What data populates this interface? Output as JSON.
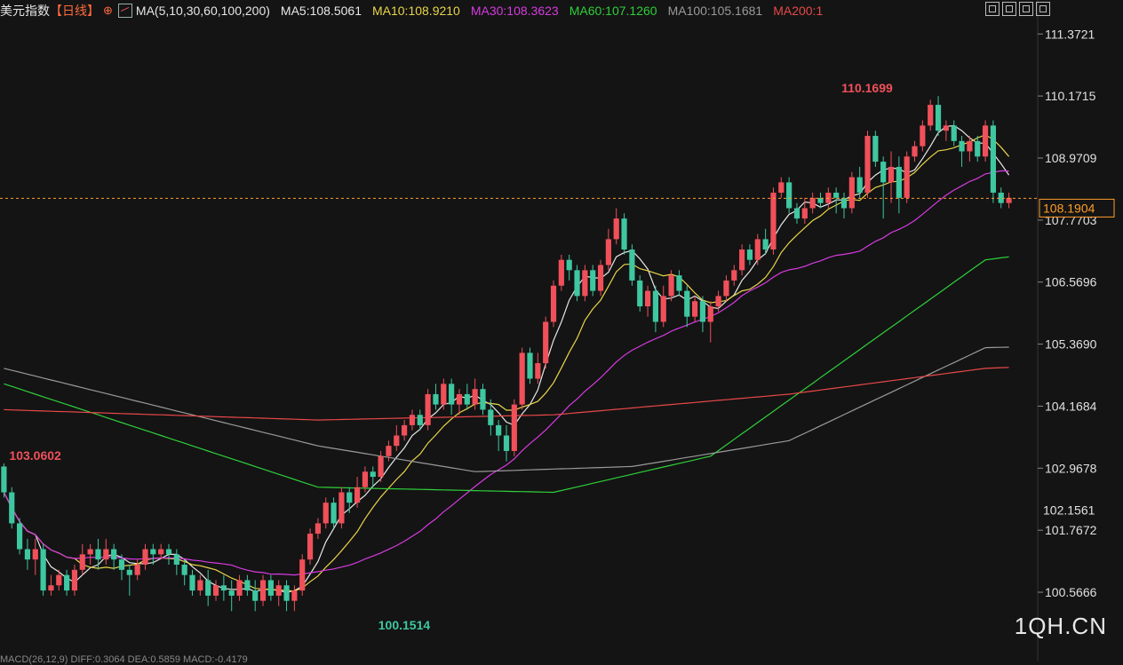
{
  "legend": {
    "title": "美元指数",
    "period": "【日线】",
    "ma_spec": "MA(5,10,30,60,100,200)",
    "items": [
      {
        "label": "MA5:108.5061",
        "color": "#e8e8e8"
      },
      {
        "label": "MA10:108.9210",
        "color": "#e8d44a"
      },
      {
        "label": "MA30:108.3623",
        "color": "#d63be0"
      },
      {
        "label": "MA60:107.1260",
        "color": "#2fcf3a"
      },
      {
        "label": "MA100:105.1681",
        "color": "#9a9a9a"
      },
      {
        "label": "MA200:1",
        "color": "#e84848"
      }
    ]
  },
  "colors": {
    "up": "#f0505a",
    "down": "#3ec7a0",
    "axis_text": "#e0e0e0",
    "price_label": "#ff9d2a",
    "current_line": "#ff9d2a"
  },
  "watermark": "1QH.CN",
  "bottom_indicator": "MACD(26,12,9) DIFF:0.3064 DEA:0.5859 MACD:-0.4179",
  "chart_data": {
    "type": "candlestick",
    "y_ticks": [
      "111.3721",
      "110.1715",
      "108.9709",
      "107.7703",
      "106.5696",
      "105.3690",
      "104.1684",
      "102.9678",
      "101.7672",
      "100.5666"
    ],
    "ylim": [
      100.0,
      111.6
    ],
    "current_price": "108.1904",
    "marker_price": "102.1561",
    "annotations": [
      {
        "text": "110.1699",
        "index": 106,
        "value": 110.1699,
        "color": "#f0505a"
      },
      {
        "text": "103.0602",
        "index": 0,
        "value": 103.0602,
        "color": "#f0505a"
      },
      {
        "text": "100.1514",
        "index": 47,
        "value": 100.1514,
        "color": "#3ec7a0"
      }
    ],
    "candles": [
      [
        103.0,
        102.5,
        103.06,
        102.4
      ],
      [
        102.5,
        101.9,
        102.6,
        101.8
      ],
      [
        101.9,
        101.4,
        102.0,
        101.3
      ],
      [
        101.4,
        101.2,
        101.6,
        101.0
      ],
      [
        101.2,
        101.4,
        101.6,
        100.9
      ],
      [
        101.4,
        100.6,
        101.5,
        100.5
      ],
      [
        100.6,
        100.7,
        100.9,
        100.5
      ],
      [
        100.7,
        100.9,
        101.0,
        100.6
      ],
      [
        100.9,
        100.6,
        101.0,
        100.5
      ],
      [
        100.6,
        101.0,
        101.1,
        100.5
      ],
      [
        101.0,
        101.3,
        101.5,
        100.9
      ],
      [
        101.3,
        101.4,
        101.5,
        101.1
      ],
      [
        101.4,
        101.2,
        101.6,
        101.0
      ],
      [
        101.2,
        101.4,
        101.6,
        101.1
      ],
      [
        101.4,
        101.2,
        101.5,
        101.0
      ],
      [
        101.2,
        101.0,
        101.3,
        100.8
      ],
      [
        101.0,
        100.9,
        101.1,
        100.5
      ],
      [
        100.9,
        101.1,
        101.2,
        100.8
      ],
      [
        101.1,
        101.4,
        101.5,
        101.0
      ],
      [
        101.4,
        101.3,
        101.5,
        101.1
      ],
      [
        101.3,
        101.4,
        101.5,
        101.2
      ],
      [
        101.4,
        101.3,
        101.5,
        101.1
      ],
      [
        101.3,
        101.1,
        101.4,
        100.9
      ],
      [
        101.1,
        100.9,
        101.2,
        100.7
      ],
      [
        100.9,
        100.6,
        101.0,
        100.5
      ],
      [
        100.6,
        100.8,
        100.9,
        100.5
      ],
      [
        100.8,
        100.5,
        101.0,
        100.3
      ],
      [
        100.5,
        100.7,
        100.8,
        100.4
      ],
      [
        100.7,
        100.6,
        100.9,
        100.4
      ],
      [
        100.6,
        100.5,
        100.8,
        100.2
      ],
      [
        100.5,
        100.8,
        100.9,
        100.4
      ],
      [
        100.8,
        100.6,
        100.9,
        100.5
      ],
      [
        100.6,
        100.4,
        100.8,
        100.2
      ],
      [
        100.4,
        100.8,
        100.9,
        100.3
      ],
      [
        100.8,
        100.5,
        100.9,
        100.4
      ],
      [
        100.5,
        100.7,
        100.8,
        100.3
      ],
      [
        100.7,
        100.4,
        100.8,
        100.2
      ],
      [
        100.4,
        100.6,
        100.7,
        100.2
      ],
      [
        100.6,
        101.2,
        101.3,
        100.5
      ],
      [
        101.2,
        101.7,
        101.8,
        101.1
      ],
      [
        101.7,
        101.9,
        102.0,
        101.6
      ],
      [
        101.9,
        102.3,
        102.4,
        101.8
      ],
      [
        102.3,
        101.9,
        102.4,
        101.8
      ],
      [
        101.9,
        102.5,
        102.6,
        101.8
      ],
      [
        102.5,
        102.3,
        102.6,
        102.1
      ],
      [
        102.3,
        102.6,
        102.8,
        102.2
      ],
      [
        102.6,
        102.9,
        103.0,
        102.5
      ],
      [
        102.9,
        102.8,
        103.0,
        102.6
      ],
      [
        102.8,
        103.2,
        103.3,
        102.7
      ],
      [
        103.2,
        103.4,
        103.5,
        103.1
      ],
      [
        103.4,
        103.6,
        103.8,
        103.3
      ],
      [
        103.6,
        103.8,
        103.9,
        103.5
      ],
      [
        103.8,
        104.0,
        104.1,
        103.7
      ],
      [
        104.0,
        103.8,
        104.1,
        103.7
      ],
      [
        103.8,
        104.4,
        104.5,
        103.7
      ],
      [
        104.4,
        104.2,
        104.6,
        104.1
      ],
      [
        104.2,
        104.6,
        104.7,
        104.1
      ],
      [
        104.6,
        104.2,
        104.7,
        104.0
      ],
      [
        104.2,
        104.4,
        104.5,
        104.0
      ],
      [
        104.4,
        104.2,
        104.6,
        104.1
      ],
      [
        104.2,
        104.5,
        104.7,
        104.1
      ],
      [
        104.5,
        104.1,
        104.6,
        104.0
      ],
      [
        104.1,
        103.8,
        104.3,
        103.6
      ],
      [
        103.8,
        103.6,
        103.9,
        103.3
      ],
      [
        103.6,
        103.3,
        103.8,
        103.1
      ],
      [
        103.3,
        104.2,
        104.3,
        103.2
      ],
      [
        104.2,
        105.2,
        105.3,
        104.1
      ],
      [
        105.2,
        104.7,
        105.3,
        104.6
      ],
      [
        104.7,
        105.0,
        105.2,
        104.6
      ],
      [
        105.0,
        105.8,
        105.9,
        104.9
      ],
      [
        105.8,
        106.5,
        106.6,
        105.7
      ],
      [
        106.5,
        107.0,
        107.1,
        106.4
      ],
      [
        107.0,
        106.8,
        107.1,
        106.6
      ],
      [
        106.8,
        106.3,
        106.9,
        106.2
      ],
      [
        106.3,
        106.8,
        106.9,
        106.2
      ],
      [
        106.8,
        106.4,
        106.9,
        106.3
      ],
      [
        106.4,
        106.9,
        107.0,
        106.3
      ],
      [
        106.9,
        107.4,
        107.6,
        106.8
      ],
      [
        107.4,
        107.8,
        108.0,
        107.3
      ],
      [
        107.8,
        107.2,
        107.9,
        107.1
      ],
      [
        107.2,
        106.6,
        107.3,
        106.5
      ],
      [
        106.6,
        106.1,
        106.7,
        106.0
      ],
      [
        106.1,
        106.4,
        106.5,
        105.9
      ],
      [
        106.4,
        105.8,
        106.5,
        105.6
      ],
      [
        105.8,
        106.3,
        106.5,
        105.7
      ],
      [
        106.3,
        106.7,
        106.8,
        106.2
      ],
      [
        106.7,
        106.4,
        106.8,
        106.3
      ],
      [
        106.4,
        105.9,
        106.5,
        105.7
      ],
      [
        105.9,
        106.2,
        106.3,
        105.8
      ],
      [
        106.2,
        105.8,
        106.3,
        105.6
      ],
      [
        105.8,
        106.1,
        106.2,
        105.4
      ],
      [
        106.1,
        106.3,
        106.4,
        106.0
      ],
      [
        106.3,
        106.6,
        106.7,
        106.2
      ],
      [
        106.6,
        106.8,
        106.9,
        106.5
      ],
      [
        106.8,
        107.2,
        107.3,
        106.7
      ],
      [
        107.2,
        107.0,
        107.3,
        106.9
      ],
      [
        107.0,
        107.4,
        107.5,
        106.9
      ],
      [
        107.4,
        107.2,
        107.6,
        107.1
      ],
      [
        107.2,
        108.3,
        108.4,
        107.1
      ],
      [
        108.3,
        108.5,
        108.6,
        108.2
      ],
      [
        108.5,
        108.0,
        108.6,
        107.9
      ],
      [
        108.0,
        107.8,
        108.1,
        107.7
      ],
      [
        107.8,
        108.0,
        108.2,
        107.7
      ],
      [
        108.0,
        108.2,
        108.3,
        107.9
      ],
      [
        108.2,
        108.1,
        108.3,
        108.0
      ],
      [
        108.1,
        108.3,
        108.4,
        108.0
      ],
      [
        108.3,
        108.2,
        108.4,
        107.9
      ],
      [
        108.2,
        108.0,
        108.3,
        107.8
      ],
      [
        108.0,
        108.6,
        108.7,
        107.9
      ],
      [
        108.6,
        108.3,
        108.8,
        108.2
      ],
      [
        108.3,
        109.4,
        109.5,
        108.2
      ],
      [
        109.4,
        108.9,
        109.5,
        108.8
      ],
      [
        108.9,
        108.5,
        109.0,
        107.8
      ],
      [
        108.5,
        108.8,
        109.1,
        108.1
      ],
      [
        108.8,
        108.2,
        109.0,
        107.9
      ],
      [
        108.2,
        109.0,
        109.1,
        108.1
      ],
      [
        109.0,
        109.2,
        109.3,
        108.9
      ],
      [
        109.2,
        109.6,
        109.7,
        109.1
      ],
      [
        109.6,
        110.0,
        110.1,
        109.5
      ],
      [
        110.0,
        109.5,
        110.17,
        109.4
      ],
      [
        109.5,
        109.6,
        109.7,
        109.3
      ],
      [
        109.6,
        109.3,
        109.7,
        109.2
      ],
      [
        109.3,
        109.1,
        109.4,
        108.8
      ],
      [
        109.1,
        109.3,
        109.4,
        108.9
      ],
      [
        109.3,
        109.0,
        109.4,
        108.9
      ],
      [
        109.0,
        109.6,
        109.7,
        108.9
      ],
      [
        109.6,
        108.3,
        109.7,
        108.1
      ],
      [
        108.3,
        108.1,
        108.4,
        108.0
      ],
      [
        108.1,
        108.2,
        108.3,
        108.0
      ]
    ],
    "series": [
      {
        "name": "MA5",
        "color": "#e8e8e8"
      },
      {
        "name": "MA10",
        "color": "#e8d44a"
      },
      {
        "name": "MA30",
        "color": "#d63be0"
      },
      {
        "name": "MA60",
        "color": "#2fcf3a",
        "start": 104.6,
        "anchors": [
          [
            0,
            104.6
          ],
          [
            40,
            102.6
          ],
          [
            70,
            102.5
          ],
          [
            90,
            103.2
          ],
          [
            125,
            107.0
          ]
        ]
      },
      {
        "name": "MA100",
        "color": "#9a9a9a",
        "anchors": [
          [
            0,
            104.9
          ],
          [
            40,
            103.4
          ],
          [
            60,
            102.9
          ],
          [
            80,
            103.0
          ],
          [
            100,
            103.5
          ],
          [
            125,
            105.3
          ]
        ]
      },
      {
        "name": "MA200",
        "color": "#e84848",
        "anchors": [
          [
            0,
            104.1
          ],
          [
            40,
            103.9
          ],
          [
            70,
            104.0
          ],
          [
            100,
            104.4
          ],
          [
            125,
            104.9
          ]
        ]
      }
    ]
  }
}
